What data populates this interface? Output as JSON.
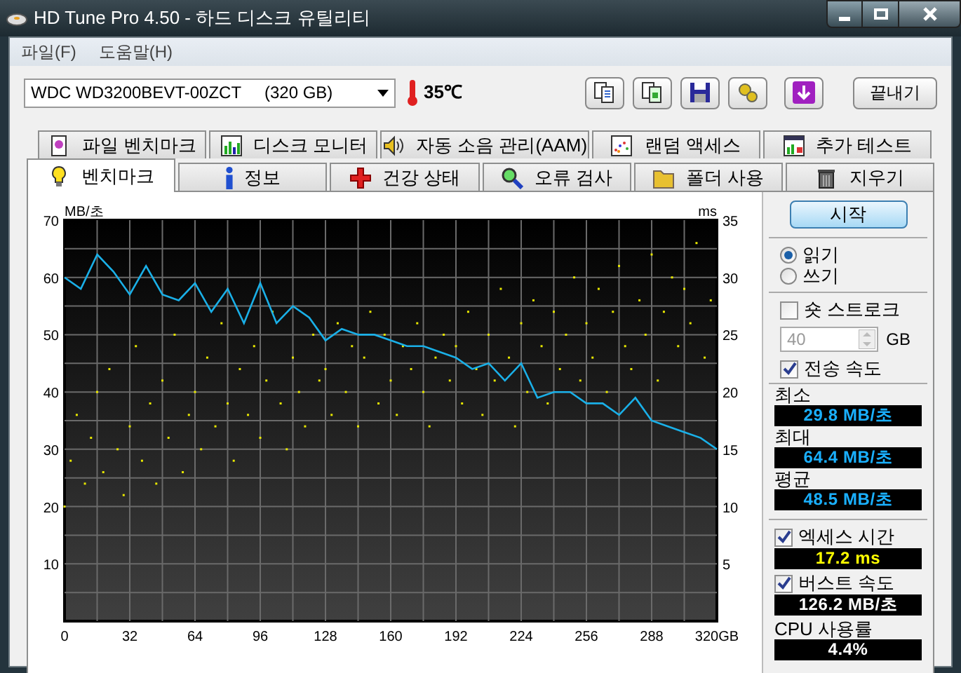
{
  "window": {
    "title": "HD Tune Pro 4.50 - 하드 디스크 유틸리티"
  },
  "menu": [
    "파일(F)",
    "도움말(H)"
  ],
  "toolbar": {
    "drive": "WDC WD3200BEVT-00ZCT     (320 GB)",
    "temperature": "35℃",
    "exit_button": "끝내기"
  },
  "tabs_top": [
    {
      "label": "파일 벤치마크",
      "selected": false
    },
    {
      "label": "디스크 모니터",
      "selected": false
    },
    {
      "label": "자동 소음 관리(AAM)",
      "selected": false
    },
    {
      "label": "랜덤 액세스",
      "selected": false
    },
    {
      "label": "추가 테스트",
      "selected": false
    }
  ],
  "tabs_bottom": [
    {
      "label": "벤치마크",
      "selected": true
    },
    {
      "label": "정보",
      "selected": false
    },
    {
      "label": "건강 상태",
      "selected": false
    },
    {
      "label": "오류 검사",
      "selected": false
    },
    {
      "label": "폴더 사용",
      "selected": false
    },
    {
      "label": "지우기",
      "selected": false
    }
  ],
  "chart": {
    "right_axis_unit": "ms",
    "chart_data": {
      "type": "line",
      "ylabel": "MB/초",
      "x": [
        0,
        8,
        16,
        24,
        32,
        40,
        48,
        56,
        64,
        72,
        80,
        88,
        96,
        104,
        112,
        120,
        128,
        136,
        144,
        152,
        160,
        168,
        176,
        184,
        192,
        200,
        208,
        216,
        224,
        232,
        240,
        248,
        256,
        264,
        272,
        280,
        288,
        296,
        304,
        312,
        320
      ],
      "series": [
        {
          "color": "#1ab0e8",
          "values": [
            60,
            58,
            64,
            61,
            57,
            62,
            57,
            56,
            59,
            54,
            58,
            52,
            59,
            52,
            55,
            53,
            49,
            51,
            50,
            50,
            49,
            48,
            48,
            47,
            46,
            44,
            45,
            42,
            45,
            39,
            40,
            40,
            38,
            38,
            36,
            39,
            35,
            34,
            33,
            32,
            30
          ]
        },
        {
          "type": "scatter",
          "axis": "y2",
          "color": "#e8e800",
          "x": [
            0,
            3,
            6,
            10,
            13,
            16,
            19,
            22,
            26,
            29,
            32,
            35,
            38,
            42,
            45,
            48,
            51,
            54,
            58,
            61,
            64,
            67,
            70,
            74,
            77,
            80,
            83,
            86,
            90,
            93,
            96,
            99,
            102,
            106,
            109,
            112,
            115,
            118,
            122,
            125,
            128,
            131,
            134,
            138,
            141,
            144,
            147,
            150,
            154,
            157,
            160,
            163,
            166,
            170,
            173,
            176,
            179,
            182,
            186,
            189,
            192,
            195,
            198,
            202,
            205,
            208,
            211,
            214,
            218,
            221,
            224,
            227,
            230,
            234,
            237,
            240,
            243,
            246,
            250,
            253,
            256,
            259,
            262,
            266,
            269,
            272,
            275,
            278,
            282,
            285,
            288,
            291,
            294,
            298,
            301,
            304,
            307,
            310,
            314,
            317
          ],
          "values": [
            10,
            14,
            18,
            12,
            16,
            20,
            13,
            22,
            15,
            11,
            17,
            24,
            14,
            19,
            12,
            21,
            16,
            25,
            13,
            18,
            20,
            15,
            23,
            17,
            26,
            19,
            14,
            22,
            18,
            24,
            16,
            21,
            27,
            19,
            15,
            23,
            20,
            17,
            25,
            21,
            22,
            18,
            26,
            20,
            24,
            17,
            23,
            27,
            19,
            25,
            21,
            18,
            24,
            22,
            26,
            20,
            17,
            23,
            25,
            21,
            24,
            19,
            27,
            22,
            18,
            25,
            21,
            29,
            23,
            17,
            26,
            20,
            28,
            24,
            19,
            27,
            22,
            25,
            30,
            21,
            26,
            23,
            29,
            20,
            27,
            31,
            24,
            22,
            28,
            25,
            32,
            21,
            27,
            30,
            24,
            29,
            26,
            33,
            23,
            28
          ]
        }
      ],
      "xlim": [
        0,
        320
      ],
      "ylim": [
        0,
        70
      ],
      "xticks": [
        0,
        32,
        64,
        96,
        128,
        160,
        192,
        224,
        256,
        288,
        {
          "value": 320,
          "label": "320GB"
        }
      ],
      "yticks": [
        10,
        20,
        30,
        40,
        50,
        60,
        70
      ],
      "y2lim": [
        0,
        35
      ],
      "grid": true,
      "y2ticks": [
        5,
        10,
        15,
        20,
        25,
        30,
        35
      ]
    }
  },
  "panel": {
    "start_button": "시작",
    "modes": [
      {
        "label": "읽기",
        "selected": true
      },
      {
        "label": "쓰기",
        "selected": false
      }
    ],
    "short_stroke": {
      "label": "숏 스트로크",
      "checked": false
    },
    "stroke_size": {
      "value": "40",
      "unit": "GB",
      "disabled": true
    },
    "transfer_rate": {
      "label": "전송 속도",
      "checked": true
    },
    "readings": [
      {
        "label": "최소",
        "value": "29.8 MB/초"
      },
      {
        "label": "최대",
        "value": "64.4 MB/초"
      },
      {
        "label": "평균",
        "value": "48.5 MB/초"
      }
    ],
    "access_time": {
      "label": "엑세스 시간",
      "checked": true,
      "value": "17.2 ms"
    },
    "burst_rate": {
      "label": "버스트 속도",
      "checked": true,
      "value": "126.2 MB/초"
    },
    "cpu": {
      "label": "CPU 사용률",
      "value": "4.4%"
    }
  }
}
